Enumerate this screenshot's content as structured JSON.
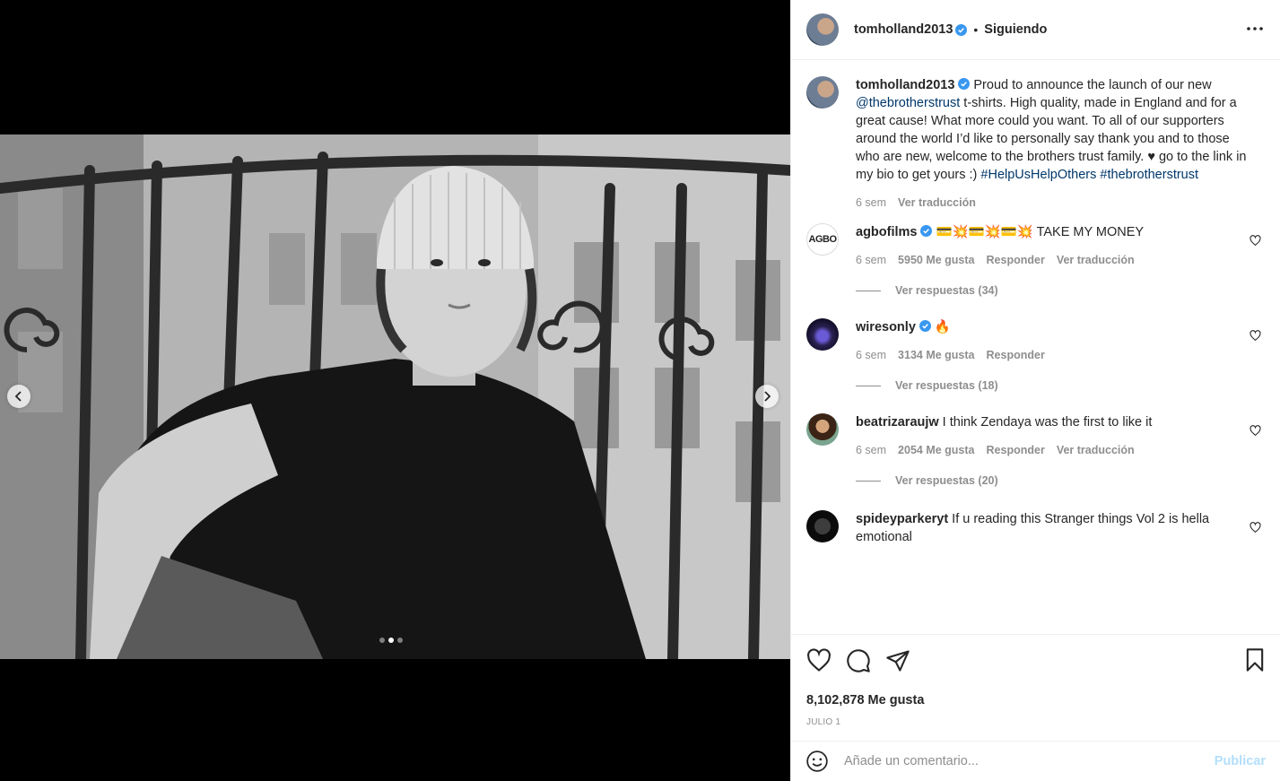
{
  "post": {
    "author": "tomholland2013",
    "follow_state": "Siguiendo",
    "caption": {
      "part1": "Proud to announce the launch of our new ",
      "mention": "@thebrotherstrust",
      "part2": " t-shirts. High quality, made in England and for a great cause! What more could you want. To all of our supporters around the world I’d like to personally say thank you and to those who are new, welcome to the brothers trust family. ♥ go to the link in my bio to get yours :) ",
      "hashtag1": "#HelpUsHelpOthers",
      "hashtag2": "#thebrotherstrust",
      "time": "6 sem",
      "translate": "Ver traducción"
    },
    "likes": "8,102,878 Me gusta",
    "date": "JULIO 1",
    "carousel": {
      "count": 3,
      "active_index": 1
    }
  },
  "comments": [
    {
      "user": "agbofilms",
      "avatar_text": "AGBO",
      "verified": true,
      "text": "💳💥💳💥💳💥 TAKE MY MONEY",
      "time": "6 sem",
      "likes": "5950 Me gusta",
      "reply": "Responder",
      "translate": "Ver traducción",
      "view_replies": "Ver respuestas (34)"
    },
    {
      "user": "wiresonly",
      "verified": true,
      "text": "🔥",
      "time": "6 sem",
      "likes": "3134 Me gusta",
      "reply": "Responder",
      "view_replies": "Ver respuestas (18)"
    },
    {
      "user": "beatrizaraujw",
      "verified": false,
      "text": "I think Zendaya was the first to like it",
      "time": "6 sem",
      "likes": "2054 Me gusta",
      "reply": "Responder",
      "translate": "Ver traducción",
      "view_replies": "Ver respuestas (20)"
    },
    {
      "user": "spideyparkeryt",
      "verified": false,
      "text": "If u reading this Stranger things Vol 2 is hella emotional"
    }
  ],
  "composer": {
    "placeholder": "Añade un comentario...",
    "publish": "Publicar"
  },
  "colors": {
    "verified": "#3897f0",
    "link": "#00376b",
    "muted": "#8e8e8e",
    "publish_disabled": "#b2dffc"
  },
  "icons": [
    "more-icon",
    "chevron-left-icon",
    "chevron-right-icon",
    "heart-icon",
    "comment-icon",
    "share-icon",
    "bookmark-icon",
    "emoji-icon",
    "verified-icon"
  ]
}
